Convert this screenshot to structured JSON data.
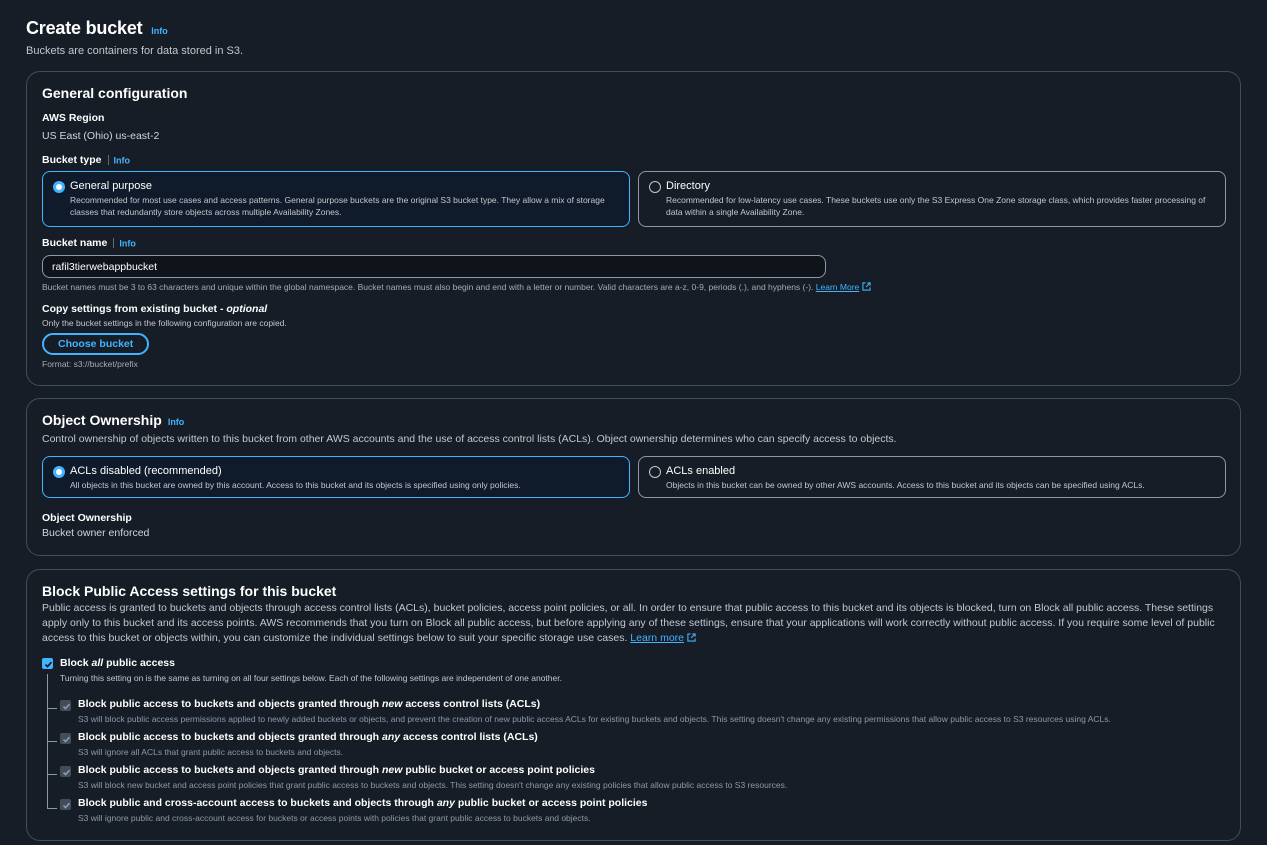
{
  "header": {
    "title": "Create bucket",
    "info": "Info",
    "subtitle": "Buckets are containers for data stored in S3."
  },
  "general": {
    "title": "General configuration",
    "region_label": "AWS Region",
    "region_value": "US East (Ohio) us-east-2",
    "bucket_type_label": "Bucket type",
    "info": "Info",
    "types": [
      {
        "title": "General purpose",
        "desc": "Recommended for most use cases and access patterns. General purpose buckets are the original S3 bucket type. They allow a mix of storage classes that redundantly store objects across multiple Availability Zones.",
        "selected": true
      },
      {
        "title": "Directory",
        "desc": "Recommended for low-latency use cases. These buckets use only the S3 Express One Zone storage class, which provides faster processing of data within a single Availability Zone.",
        "selected": false
      }
    ],
    "bucket_name_label": "Bucket name",
    "bucket_name_value": "rafil3tierwebappbucket",
    "bucket_name_hint": "Bucket names must be 3 to 63 characters and unique within the global namespace. Bucket names must also begin and end with a letter or number. Valid characters are a-z, 0-9, periods (.), and hyphens (-).",
    "learn_more": "Learn More",
    "copy_label": "Copy settings from existing bucket - ",
    "copy_optional": "optional",
    "copy_desc": "Only the bucket settings in the following configuration are copied.",
    "choose_button": "Choose bucket",
    "format_hint": "Format: s3://bucket/prefix"
  },
  "ownership": {
    "title": "Object Ownership",
    "info": "Info",
    "desc": "Control ownership of objects written to this bucket from other AWS accounts and the use of access control lists (ACLs). Object ownership determines who can specify access to objects.",
    "options": [
      {
        "title": "ACLs disabled (recommended)",
        "desc": "All objects in this bucket are owned by this account. Access to this bucket and its objects is specified using only policies.",
        "selected": true
      },
      {
        "title": "ACLs enabled",
        "desc": "Objects in this bucket can be owned by other AWS accounts. Access to this bucket and its objects can be specified using ACLs.",
        "selected": false
      }
    ],
    "result_label": "Object Ownership",
    "result_value": "Bucket owner enforced"
  },
  "block": {
    "title": "Block Public Access settings for this bucket",
    "desc": "Public access is granted to buckets and objects through access control lists (ACLs), bucket policies, access point policies, or all. In order to ensure that public access to this bucket and its objects is blocked, turn on Block all public access. These settings apply only to this bucket and its access points. AWS recommends that you turn on Block all public access, but before applying any of these settings, ensure that your applications will work correctly without public access. If you require some level of public access to this bucket or objects within, you can customize the individual settings below to suit your specific storage use cases.",
    "learn_more": "Learn more",
    "all": {
      "pre": "Block ",
      "em": "all",
      "post": " public access",
      "desc": "Turning this setting on is the same as turning on all four settings below. Each of the following settings are independent of one another.",
      "checked": true
    },
    "items": [
      {
        "pre": "Block public access to buckets and objects granted through ",
        "em": "new",
        "post": " access control lists (ACLs)",
        "desc": "S3 will block public access permissions applied to newly added buckets or objects, and prevent the creation of new public access ACLs for existing buckets and objects. This setting doesn't change any existing permissions that allow public access to S3 resources using ACLs."
      },
      {
        "pre": "Block public access to buckets and objects granted through ",
        "em": "any",
        "post": " access control lists (ACLs)",
        "desc": "S3 will ignore all ACLs that grant public access to buckets and objects."
      },
      {
        "pre": "Block public access to buckets and objects granted through ",
        "em": "new",
        "post": " public bucket or access point policies",
        "desc": "S3 will block new bucket and access point policies that grant public access to buckets and objects. This setting doesn't change any existing policies that allow public access to S3 resources."
      },
      {
        "pre": "Block public and cross-account access to buckets and objects through ",
        "em": "any",
        "post": " public bucket or access point policies",
        "desc": "S3 will ignore public and cross-account access for buckets or access points with policies that grant public access to buckets and objects."
      }
    ]
  }
}
